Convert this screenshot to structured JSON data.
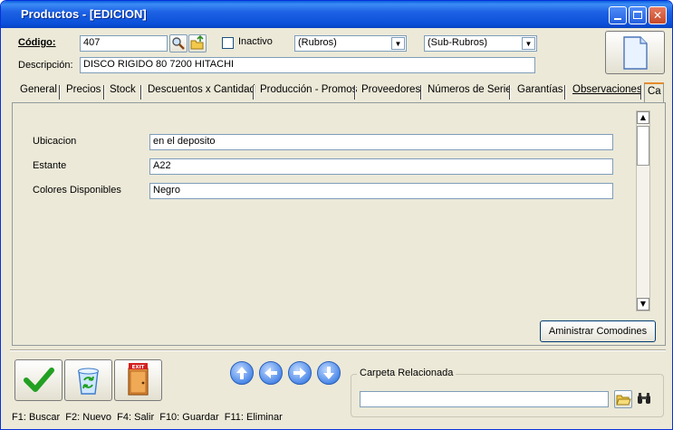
{
  "window": {
    "title": "Productos - [EDICION]"
  },
  "header": {
    "codigo_label": "Código:",
    "codigo_value": "407",
    "inactivo_label": "Inactivo",
    "rubros_value": "(Rubros)",
    "subrubros_value": "(Sub-Rubros)",
    "descripcion_label": "Descripción:",
    "descripcion_value": "DISCO RIGIDO 80 7200  HITACHI"
  },
  "tabs": [
    {
      "label": "General"
    },
    {
      "label": "Precios"
    },
    {
      "label": "Stock"
    },
    {
      "label": "Descuentos x Cantidad"
    },
    {
      "label": "Producción - Promos"
    },
    {
      "label": "Proveedores"
    },
    {
      "label": "Números de Serie"
    },
    {
      "label": "Garantías"
    },
    {
      "label": "Observaciones"
    },
    {
      "label": "Ca"
    }
  ],
  "fields": [
    {
      "label": "Ubicacion",
      "value": "en el deposito"
    },
    {
      "label": "Estante",
      "value": "A22"
    },
    {
      "label": "Colores Disponibles",
      "value": "Negro"
    }
  ],
  "buttons": {
    "administrar_comodines": "Aministrar Comodines",
    "exit_icon_text": "EXIT"
  },
  "carpeta": {
    "title": "Carpeta Relacionada",
    "value": ""
  },
  "status_bar": "F1: Buscar  F2: Nuevo  F4: Salir  F10: Guardar  F11: Eliminar",
  "colors": {
    "titlebar": "#0A50D8",
    "window_bg": "#ECE9D8",
    "check_green": "#22A022",
    "nav_blue": "#4E8AE8"
  },
  "icons": [
    "search-icon",
    "folder-up-icon",
    "document-icon",
    "check-icon",
    "recycle-icon",
    "exit-door-icon",
    "arrow-up-icon",
    "arrow-left-icon",
    "arrow-right-icon",
    "arrow-down-icon",
    "folder-open-icon",
    "binoculars-icon"
  ]
}
